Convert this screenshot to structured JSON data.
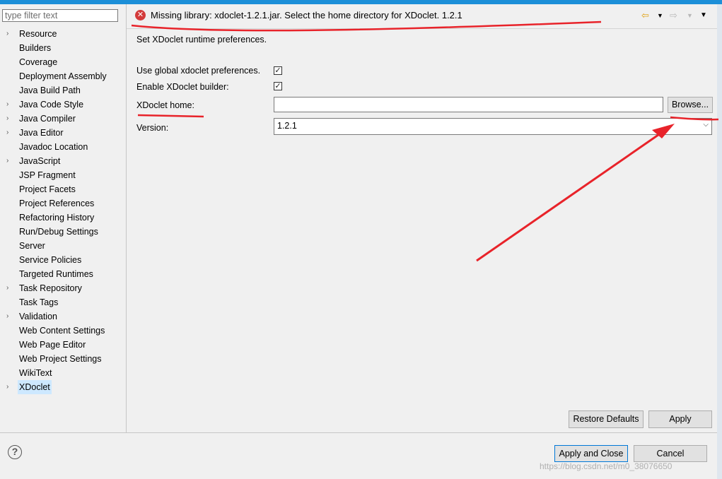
{
  "filter": {
    "placeholder": "type filter text"
  },
  "tree": [
    {
      "label": "Resource",
      "expandable": true
    },
    {
      "label": "Builders",
      "expandable": false
    },
    {
      "label": "Coverage",
      "expandable": false
    },
    {
      "label": "Deployment Assembly",
      "expandable": false
    },
    {
      "label": "Java Build Path",
      "expandable": false
    },
    {
      "label": "Java Code Style",
      "expandable": true
    },
    {
      "label": "Java Compiler",
      "expandable": true
    },
    {
      "label": "Java Editor",
      "expandable": true
    },
    {
      "label": "Javadoc Location",
      "expandable": false
    },
    {
      "label": "JavaScript",
      "expandable": true
    },
    {
      "label": "JSP Fragment",
      "expandable": false
    },
    {
      "label": "Project Facets",
      "expandable": false
    },
    {
      "label": "Project References",
      "expandable": false
    },
    {
      "label": "Refactoring History",
      "expandable": false
    },
    {
      "label": "Run/Debug Settings",
      "expandable": false
    },
    {
      "label": "Server",
      "expandable": false
    },
    {
      "label": "Service Policies",
      "expandable": false
    },
    {
      "label": "Targeted Runtimes",
      "expandable": false
    },
    {
      "label": "Task Repository",
      "expandable": true
    },
    {
      "label": "Task Tags",
      "expandable": false
    },
    {
      "label": "Validation",
      "expandable": true
    },
    {
      "label": "Web Content Settings",
      "expandable": false
    },
    {
      "label": "Web Page Editor",
      "expandable": false
    },
    {
      "label": "Web Project Settings",
      "expandable": false
    },
    {
      "label": "WikiText",
      "expandable": false
    },
    {
      "label": "XDoclet",
      "expandable": true,
      "selected": true
    }
  ],
  "header": {
    "message": "Missing library: xdoclet-1.2.1.jar. Select the home directory for XDoclet. 1.2.1",
    "icon": "error-icon"
  },
  "description": "Set XDoclet runtime preferences.",
  "form": {
    "use_global_label": "Use global xdoclet preferences.",
    "use_global_checked": "✓",
    "enable_builder_label": "Enable XDoclet builder:",
    "enable_builder_checked": "✓",
    "home_label": "XDoclet home:",
    "home_value": "",
    "browse_label": "Browse...",
    "version_label": "Version:",
    "version_value": "1.2.1"
  },
  "buttons": {
    "restore_defaults": "Restore Defaults",
    "apply": "Apply",
    "apply_close": "Apply and Close",
    "cancel": "Cancel"
  },
  "watermark": "https://blog.csdn.net/m0_38076650",
  "colors": {
    "accent": "#0078d7",
    "annotation": "#e8232a",
    "selected": "#cde8ff"
  }
}
